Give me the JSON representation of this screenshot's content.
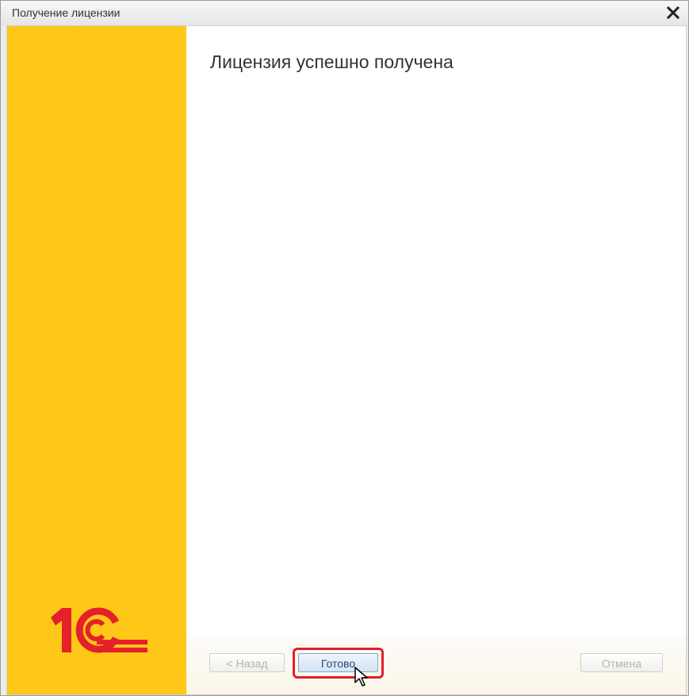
{
  "window": {
    "title": "Получение лицензии",
    "close_icon": "close-icon"
  },
  "sidebar": {
    "background_color": "#ffc718",
    "logo_icon": "1c-logo",
    "logo_color": "#e4202a"
  },
  "main": {
    "heading": "Лицензия успешно получена"
  },
  "footer": {
    "back_label": "< Назад",
    "back_enabled": false,
    "done_label": "Готово",
    "done_highlight_color": "#e0202a",
    "cancel_label": "Отмена",
    "cancel_enabled": false
  },
  "cursor_icon": "mouse-pointer-icon"
}
